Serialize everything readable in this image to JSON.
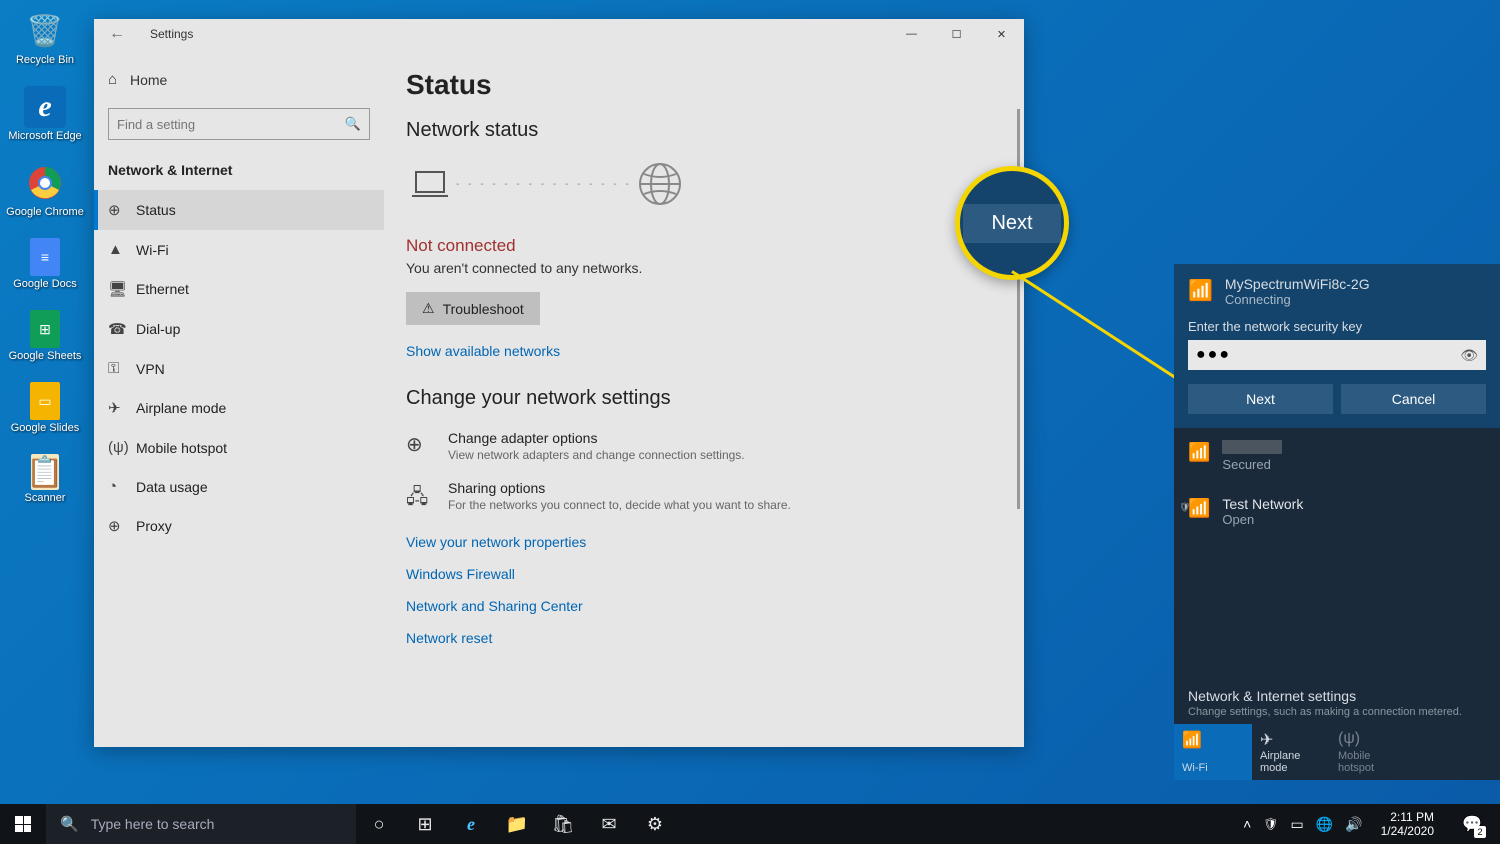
{
  "desktop_icons": [
    {
      "name": "recycle-bin",
      "label": "Recycle Bin",
      "glyph": "🗑️"
    },
    {
      "name": "edge",
      "label": "Microsoft Edge",
      "glyph": "e"
    },
    {
      "name": "chrome",
      "label": "Google Chrome",
      "glyph": "◯"
    },
    {
      "name": "docs",
      "label": "Google Docs",
      "glyph": "📄"
    },
    {
      "name": "sheets",
      "label": "Google Sheets",
      "glyph": "📊"
    },
    {
      "name": "slides",
      "label": "Google Slides",
      "glyph": "📙"
    },
    {
      "name": "scanner",
      "label": "Scanner",
      "glyph": "📁"
    }
  ],
  "window": {
    "title": "Settings",
    "home": "Home",
    "search_placeholder": "Find a setting",
    "category": "Network & Internet",
    "nav": [
      {
        "icon": "⊕",
        "label": "Status",
        "sel": true
      },
      {
        "icon": "▲",
        "label": "Wi-Fi"
      },
      {
        "icon": "🖥",
        "label": "Ethernet"
      },
      {
        "icon": "☎",
        "label": "Dial-up"
      },
      {
        "icon": "⚿",
        "label": "VPN"
      },
      {
        "icon": "✈",
        "label": "Airplane mode"
      },
      {
        "icon": "(ψ)",
        "label": "Mobile hotspot"
      },
      {
        "icon": "◔",
        "label": "Data usage"
      },
      {
        "icon": "⊕",
        "label": "Proxy"
      }
    ]
  },
  "main": {
    "title": "Status",
    "subtitle": "Network status",
    "not_connected": "Not connected",
    "not_desc": "You aren't connected to any networks.",
    "troubleshoot": "Troubleshoot",
    "show_networks": "Show available networks",
    "change_heading": "Change your network settings",
    "opt1_title": "Change adapter options",
    "opt1_desc": "View network adapters and change connection settings.",
    "opt2_title": "Sharing options",
    "opt2_desc": "For the networks you connect to, decide what you want to share.",
    "links": [
      "View your network properties",
      "Windows Firewall",
      "Network and Sharing Center",
      "Network reset"
    ]
  },
  "flyout": {
    "net_name": "MySpectrumWiFi8c-2G",
    "net_status": "Connecting",
    "prompt": "Enter the network security key",
    "password": "●●●",
    "next": "Next",
    "cancel": "Cancel",
    "net2_status": "Secured",
    "net3_name": "Test Network",
    "net3_status": "Open",
    "settings_title": "Network & Internet settings",
    "settings_desc": "Change settings, such as making a connection metered.",
    "tile_wifi": "Wi-Fi",
    "tile_airplane": "Airplane mode",
    "tile_hotspot": "Mobile hotspot"
  },
  "callout": "Next",
  "taskbar": {
    "search_placeholder": "Type here to search",
    "time": "2:11 PM",
    "date": "1/24/2020",
    "notif_count": "2"
  }
}
